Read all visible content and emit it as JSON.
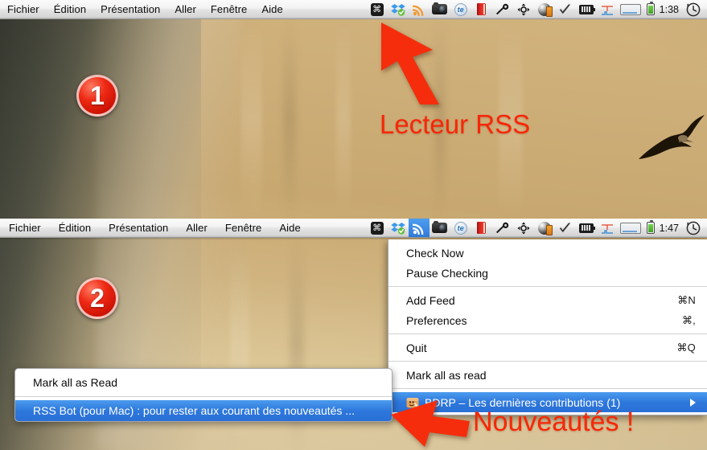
{
  "desktop": {
    "wallpaper_description": "canyon-sandstone-wallpaper",
    "bird": "flying-eagle-silhouette"
  },
  "colors": {
    "annotation_red": "#f82608",
    "menu_highlight_blue": "#2d77dc",
    "badge_red": "#d81606"
  },
  "menubar_top": {
    "apps": [
      "Fichier",
      "Édition",
      "Présentation",
      "Aller",
      "Fenêtre",
      "Aide"
    ],
    "status_icons": [
      {
        "name": "command-icon",
        "glyph": "⌘"
      },
      {
        "name": "dropbox-icon",
        "glyph": ""
      },
      {
        "name": "rss-icon",
        "glyph": ""
      },
      {
        "name": "camera-icon",
        "glyph": ""
      },
      {
        "name": "textexpander-icon",
        "glyph": "te"
      },
      {
        "name": "red-book-icon",
        "glyph": ""
      },
      {
        "name": "flashlight-icon",
        "glyph": ""
      },
      {
        "name": "move-crosshair-icon",
        "glyph": ""
      },
      {
        "name": "globe-icon",
        "glyph": ""
      },
      {
        "name": "checkmark-icon",
        "glyph": ""
      },
      {
        "name": "black-battery-icon",
        "glyph": ""
      },
      {
        "name": "activity-chart-icon",
        "glyph": ""
      },
      {
        "name": "display-icon",
        "glyph": ""
      },
      {
        "name": "green-battery-icon",
        "glyph": ""
      }
    ],
    "clock": "1:38",
    "time_machine_icon": "time-machine-icon",
    "selected_icon": null
  },
  "menubar_bottom": {
    "apps": [
      "Fichier",
      "Édition",
      "Présentation",
      "Aller",
      "Fenêtre",
      "Aide"
    ],
    "clock": "1:47",
    "selected_icon": "rss-icon"
  },
  "rss_menu": {
    "items": [
      {
        "label": "Check Now",
        "shortcut": "",
        "highlighted": false,
        "separator_after": false
      },
      {
        "label": "Pause Checking",
        "shortcut": "",
        "highlighted": false,
        "separator_after": true
      },
      {
        "label": "Add Feed",
        "shortcut": "⌘N",
        "highlighted": false,
        "separator_after": false
      },
      {
        "label": "Preferences",
        "shortcut": "⌘,",
        "highlighted": false,
        "separator_after": true
      },
      {
        "label": "Quit",
        "shortcut": "⌘Q",
        "highlighted": false,
        "separator_after": true
      },
      {
        "label": "Mark all as read",
        "shortcut": "",
        "highlighted": false,
        "separator_after": true
      }
    ],
    "feed_item": {
      "icon": "bdrp-feed-favicon",
      "label": "BDRP – Les dernières contributions (1)",
      "has_submenu": true,
      "highlighted": true
    }
  },
  "feed_submenu": {
    "items": [
      {
        "label": "Mark all as Read",
        "highlighted": false,
        "separator_after": true
      },
      {
        "label": "RSS Bot (pour Mac) : pour rester aux courant des nouveautés ...",
        "highlighted": true,
        "separator_after": false
      }
    ]
  },
  "badges": [
    {
      "number": "1"
    },
    {
      "number": "2"
    }
  ],
  "annotations": [
    {
      "id": "lecteur-rss",
      "text": "Lecteur RSS"
    },
    {
      "id": "nouveautes",
      "text": "Nouveautés !"
    }
  ],
  "arrows": [
    {
      "name": "arrow-pointing-to-rss-menubar-icon",
      "direction": "up-left"
    },
    {
      "name": "arrow-pointing-to-feed-submenu-item",
      "direction": "left"
    }
  ]
}
